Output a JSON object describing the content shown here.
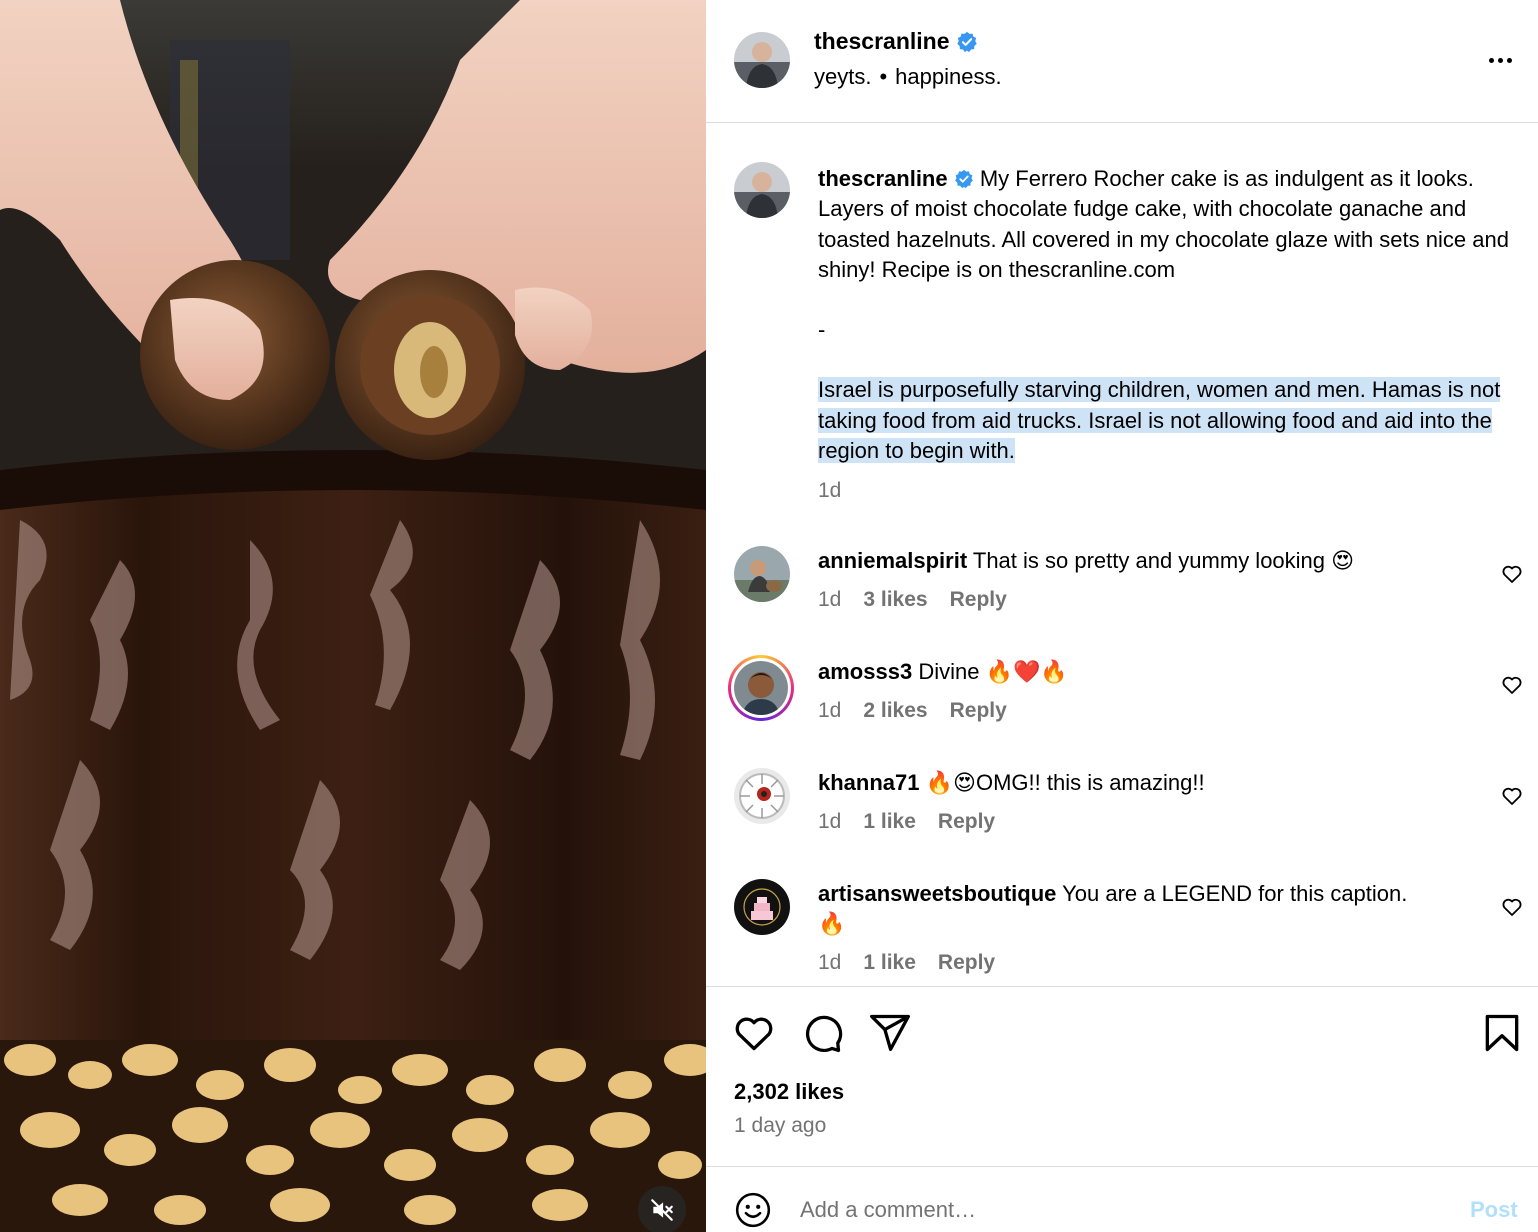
{
  "post": {
    "author": "thescranline",
    "audio_artist": "yeyts.",
    "audio_track": "happiness.",
    "separator": "•",
    "more_label": "More options"
  },
  "caption": {
    "username": "thescranline",
    "paragraph1": "My Ferrero Rocher cake is as indulgent as it looks. Layers of moist chocolate fudge cake, with chocolate ganache and toasted hazelnuts. All covered in my chocolate glaze with sets nice and shiny! Recipe is on thescranline.com",
    "divider": "-",
    "paragraph2_highlighted": "Israel is purposefully starving children, women and men. Hamas is not taking food from aid trucks. Israel is not allowing food and aid into the region to begin with. ",
    "time": "1d"
  },
  "comments": [
    {
      "username": "anniemalspirit",
      "text": "That is so pretty and yummy looking",
      "emoji": "😍",
      "time": "1d",
      "likes": "3 likes",
      "reply": "Reply"
    },
    {
      "username": "amosss3",
      "text": "Divine",
      "emoji": "🔥❤️🔥",
      "time": "1d",
      "likes": "2 likes",
      "reply": "Reply"
    },
    {
      "username": "khanna71",
      "prefix_emoji": "🔥😍",
      "text": "OMG!! this is amazing!!",
      "time": "1d",
      "likes": "1 like",
      "reply": "Reply"
    },
    {
      "username": "artisansweetsboutique",
      "text": "You are a LEGEND for this caption.",
      "emoji": "🔥",
      "time": "1d",
      "likes": "1 like",
      "reply": "Reply"
    }
  ],
  "footer": {
    "likes": "2,302 likes",
    "posted": "1 day ago",
    "comment_placeholder": "Add a comment…",
    "post_label": "Post"
  },
  "colors": {
    "verified": "#3897f0",
    "highlight": "#cfe3f7",
    "muted_text": "#737373",
    "post_button": "#b2dffc"
  },
  "icons": {
    "verified": "verified-badge-icon",
    "like": "heart-icon",
    "comment": "comment-bubble-icon",
    "share": "paper-plane-icon",
    "save": "bookmark-icon",
    "emoji": "smiley-icon",
    "mute": "speaker-muted-icon"
  }
}
